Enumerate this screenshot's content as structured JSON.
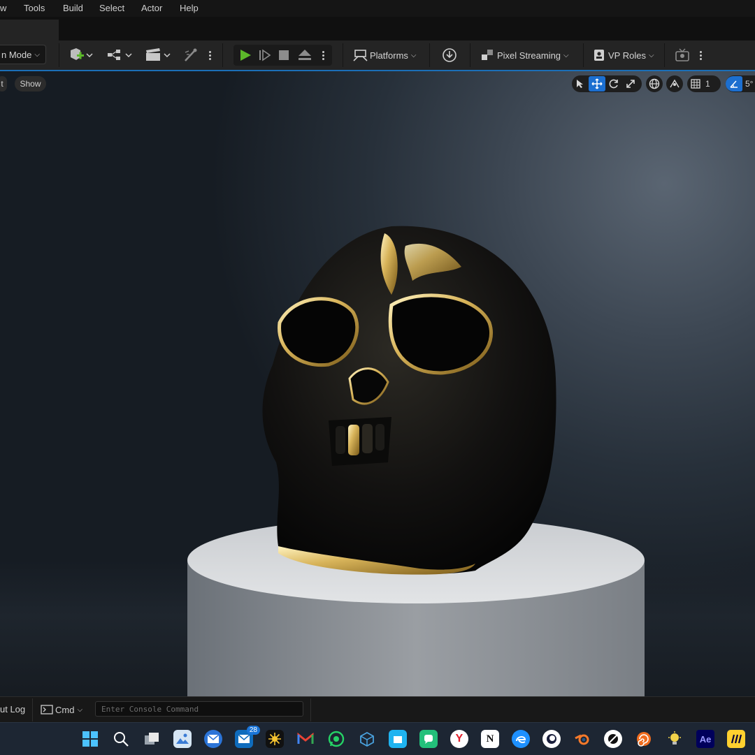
{
  "menu": {
    "items": [
      {
        "id": "window",
        "label": "w"
      },
      {
        "id": "tools",
        "label": "Tools"
      },
      {
        "id": "build",
        "label": "Build"
      },
      {
        "id": "select",
        "label": "Select"
      },
      {
        "id": "actor",
        "label": "Actor"
      },
      {
        "id": "help",
        "label": "Help"
      }
    ]
  },
  "toolbar": {
    "mode_label": "n Mode",
    "platforms_label": "Platforms",
    "pixel_streaming_label": "Pixel Streaming",
    "vp_roles_label": "VP Roles",
    "play_color": "#5cb82a"
  },
  "viewport": {
    "left_pill_label": "t",
    "show_label": "Show",
    "grid_value": "1",
    "angle_value": "5°",
    "accent_color": "#1c6fd0"
  },
  "console": {
    "output_log_label": "ut Log",
    "cmd_label": "Cmd",
    "input_placeholder": "Enter Console Command"
  },
  "taskbar": {
    "icons": [
      "windows-start",
      "search",
      "task-view",
      "photos",
      "mail",
      "outlook",
      "sunflower-app",
      "gmail",
      "whatsapp",
      "box-app",
      "store-app",
      "chat-app",
      "yandex",
      "notion",
      "edge-app",
      "cinema4d",
      "blender",
      "browser-app",
      "houdini",
      "lightbulb-app",
      "after-effects",
      "miro"
    ],
    "outlook_badge": "28",
    "after_effects_label": "Ae"
  }
}
